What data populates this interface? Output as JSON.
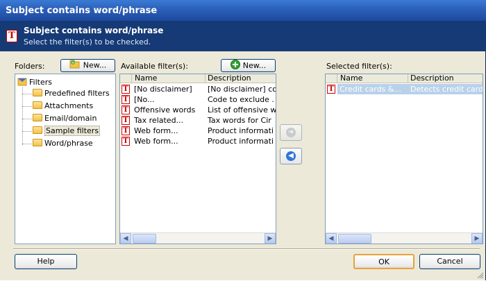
{
  "window": {
    "title": "Subject contains word/phrase"
  },
  "header": {
    "title": "Subject contains word/phrase",
    "subtitle": "Select the filter(s) to be checked.",
    "icon": "text-filter-icon"
  },
  "folders": {
    "label": "Folders:",
    "new_button": "New...",
    "tree": {
      "root": "Filters",
      "items": [
        "Predefined filters",
        "Attachments",
        "Email/domain",
        "Sample filters",
        "Word/phrase"
      ],
      "selected": "Sample filters"
    }
  },
  "available": {
    "label": "Available filter(s):",
    "new_button": "New...",
    "columns": [
      "Name",
      "Description"
    ],
    "rows": [
      {
        "name": "[No disclaimer]",
        "description": "[No disclaimer] co"
      },
      {
        "name": "[No...",
        "description": "Code to exclude ."
      },
      {
        "name": "Offensive words",
        "description": "List of offensive w"
      },
      {
        "name": "Tax related...",
        "description": "Tax words for Cir"
      },
      {
        "name": "Web form...",
        "description": "Product informati"
      },
      {
        "name": "Web form...",
        "description": "Product informati"
      }
    ]
  },
  "move": {
    "add_icon": "arrow-right-icon",
    "remove_icon": "arrow-left-icon"
  },
  "selected": {
    "label": "Selected filter(s):",
    "columns": [
      "Name",
      "Description"
    ],
    "rows": [
      {
        "name": "Credit cards &...",
        "description": "Detects credit card"
      }
    ]
  },
  "buttons": {
    "help": "Help",
    "ok": "OK",
    "cancel": "Cancel"
  },
  "colors": {
    "title_bar": "#2b5fb8",
    "header": "#163a76",
    "dialog_bg": "#ece9d8",
    "selection": "#b9d1ea"
  }
}
